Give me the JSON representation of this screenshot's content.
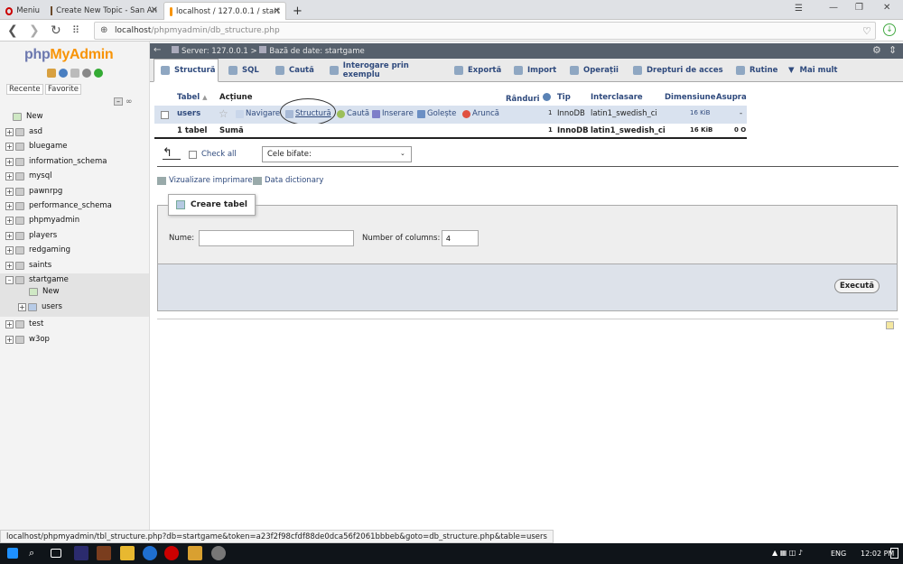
{
  "browser": {
    "menu_label": "Meniu",
    "tabs": [
      {
        "title": "Create New Topic - San An"
      },
      {
        "title": "localhost / 127.0.0.1 / start"
      }
    ],
    "new_tab": "+",
    "url_host": "localhost",
    "url_path": "/phpmyadmin/db_structure.php"
  },
  "sidebar": {
    "logo_php": "php",
    "logo_myadmin": "MyAdmin",
    "tab_recent": "Recente",
    "tab_favorite": "Favorite",
    "items": [
      {
        "label": "New"
      },
      {
        "label": "asd"
      },
      {
        "label": "bluegame"
      },
      {
        "label": "information_schema"
      },
      {
        "label": "mysql"
      },
      {
        "label": "pawnrpg"
      },
      {
        "label": "performance_schema"
      },
      {
        "label": "phpmyadmin"
      },
      {
        "label": "players"
      },
      {
        "label": "redgaming"
      },
      {
        "label": "saints"
      },
      {
        "label": "startgame"
      },
      {
        "label": "New"
      },
      {
        "label": "users"
      },
      {
        "label": "test"
      },
      {
        "label": "w3op"
      }
    ]
  },
  "breadcrumb": {
    "server": "Server: 127.0.0.1",
    "separator": ">",
    "database": "Bază de date: startgame"
  },
  "nav": [
    {
      "label": "Structură"
    },
    {
      "label": "SQL"
    },
    {
      "label": "Caută"
    },
    {
      "label": "Interogare prin exemplu"
    },
    {
      "label": "Exportă"
    },
    {
      "label": "Import"
    },
    {
      "label": "Operații"
    },
    {
      "label": "Drepturi de acces"
    },
    {
      "label": "Rutine"
    },
    {
      "label": "Mai mult"
    }
  ],
  "table": {
    "headers": {
      "table": "Tabel",
      "action": "Acțiune",
      "rows": "Rânduri",
      "type": "Tip",
      "collation": "Interclasare",
      "size": "Dimensiune",
      "overhead": "Asupra"
    },
    "row": {
      "name": "users",
      "actions": [
        "Navigare",
        "Structură",
        "Caută",
        "Inserare",
        "Golește",
        "Aruncă"
      ],
      "rows": "1",
      "type": "InnoDB",
      "collation": "latin1_swedish_ci",
      "size": "16 KiB",
      "overhead": "-"
    },
    "sum": {
      "label": "1 tabel",
      "sum_label": "Sumă",
      "rows": "1",
      "type": "InnoDB",
      "collation": "latin1_swedish_ci",
      "size": "16 KiB",
      "overhead": "0 O"
    }
  },
  "bulk": {
    "check_all": "Check all",
    "with_selected": "Cele bifate:"
  },
  "links": {
    "print_view": "Vizualizare imprimare",
    "data_dictionary": "Data dictionary"
  },
  "create_table": {
    "legend": "Creare tabel",
    "name_label": "Nume:",
    "name_value": "",
    "columns_label": "Number of columns:",
    "columns_value": "4",
    "go_button": "Execută"
  },
  "status_url": "localhost/phpmyadmin/tbl_structure.php?db=startgame&token=a23f2f98cfdf88de0dca56f2061bbbeb&goto=db_structure.php&table=users",
  "taskbar": {
    "lang": "ENG",
    "time": "12:02 PM"
  }
}
